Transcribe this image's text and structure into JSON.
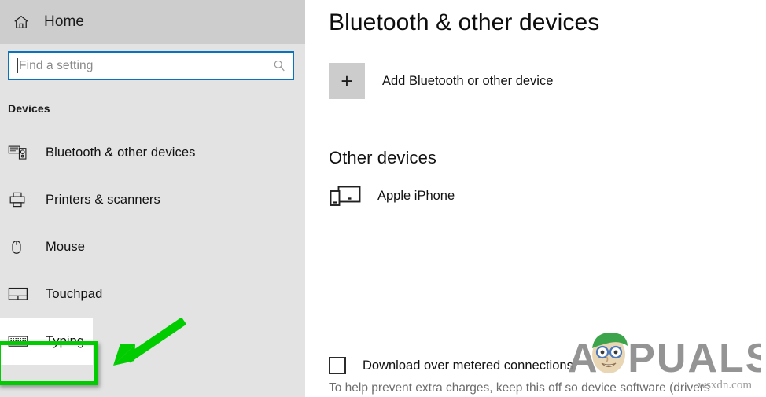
{
  "sidebar": {
    "home": {
      "label": "Home",
      "icon": "home-icon"
    },
    "search": {
      "value": "",
      "placeholder": "Find a setting",
      "icon": "search-icon"
    },
    "section_title": "Devices",
    "items": [
      {
        "label": "Bluetooth & other devices",
        "icon": "bluetooth-devices-icon",
        "selected": false
      },
      {
        "label": "Printers & scanners",
        "icon": "printer-icon",
        "selected": false
      },
      {
        "label": "Mouse",
        "icon": "mouse-icon",
        "selected": false
      },
      {
        "label": "Touchpad",
        "icon": "touchpad-icon",
        "selected": false
      },
      {
        "label": "Typing",
        "icon": "keyboard-icon",
        "selected": true
      }
    ]
  },
  "main": {
    "title": "Bluetooth & other devices",
    "add_device": {
      "label": "Add Bluetooth or other device",
      "icon": "plus-icon",
      "glyph": "+"
    },
    "other_devices_heading": "Other devices",
    "devices": [
      {
        "name": "Apple iPhone",
        "icon": "phone-and-monitor-icon"
      }
    ],
    "metered": {
      "label": "Download over metered connections",
      "checked": false,
      "description": "To help prevent extra charges, keep this off so device software (drivers"
    }
  },
  "annotations": {
    "highlight_color": "#00cc00",
    "arrow": {
      "color": "#00cc00",
      "points_to": "sidebar-item-typing"
    }
  },
  "watermark": {
    "brand": "APPUALS",
    "url": "wsxdn.com",
    "brand_color": "#8c8c8c"
  },
  "theme": {
    "sidebar_bg": "#e3e3e3",
    "header_bg": "#cdcdcd",
    "panel_bg": "#ffffff",
    "accent": "#0a73bd",
    "text": "#111111",
    "muted_text": "#6d6d6d"
  }
}
